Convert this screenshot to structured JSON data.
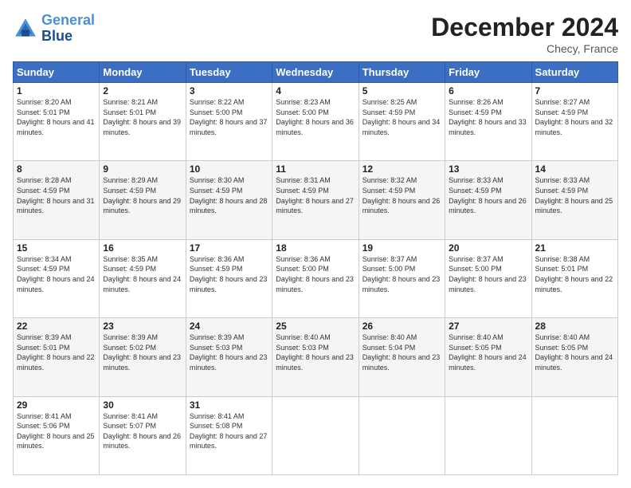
{
  "logo": {
    "line1": "General",
    "line2": "Blue"
  },
  "title": "December 2024",
  "location": "Checy, France",
  "days_of_week": [
    "Sunday",
    "Monday",
    "Tuesday",
    "Wednesday",
    "Thursday",
    "Friday",
    "Saturday"
  ],
  "weeks": [
    [
      {
        "day": "1",
        "sunrise": "Sunrise: 8:20 AM",
        "sunset": "Sunset: 5:01 PM",
        "daylight": "Daylight: 8 hours and 41 minutes."
      },
      {
        "day": "2",
        "sunrise": "Sunrise: 8:21 AM",
        "sunset": "Sunset: 5:01 PM",
        "daylight": "Daylight: 8 hours and 39 minutes."
      },
      {
        "day": "3",
        "sunrise": "Sunrise: 8:22 AM",
        "sunset": "Sunset: 5:00 PM",
        "daylight": "Daylight: 8 hours and 37 minutes."
      },
      {
        "day": "4",
        "sunrise": "Sunrise: 8:23 AM",
        "sunset": "Sunset: 5:00 PM",
        "daylight": "Daylight: 8 hours and 36 minutes."
      },
      {
        "day": "5",
        "sunrise": "Sunrise: 8:25 AM",
        "sunset": "Sunset: 4:59 PM",
        "daylight": "Daylight: 8 hours and 34 minutes."
      },
      {
        "day": "6",
        "sunrise": "Sunrise: 8:26 AM",
        "sunset": "Sunset: 4:59 PM",
        "daylight": "Daylight: 8 hours and 33 minutes."
      },
      {
        "day": "7",
        "sunrise": "Sunrise: 8:27 AM",
        "sunset": "Sunset: 4:59 PM",
        "daylight": "Daylight: 8 hours and 32 minutes."
      }
    ],
    [
      {
        "day": "8",
        "sunrise": "Sunrise: 8:28 AM",
        "sunset": "Sunset: 4:59 PM",
        "daylight": "Daylight: 8 hours and 31 minutes."
      },
      {
        "day": "9",
        "sunrise": "Sunrise: 8:29 AM",
        "sunset": "Sunset: 4:59 PM",
        "daylight": "Daylight: 8 hours and 29 minutes."
      },
      {
        "day": "10",
        "sunrise": "Sunrise: 8:30 AM",
        "sunset": "Sunset: 4:59 PM",
        "daylight": "Daylight: 8 hours and 28 minutes."
      },
      {
        "day": "11",
        "sunrise": "Sunrise: 8:31 AM",
        "sunset": "Sunset: 4:59 PM",
        "daylight": "Daylight: 8 hours and 27 minutes."
      },
      {
        "day": "12",
        "sunrise": "Sunrise: 8:32 AM",
        "sunset": "Sunset: 4:59 PM",
        "daylight": "Daylight: 8 hours and 26 minutes."
      },
      {
        "day": "13",
        "sunrise": "Sunrise: 8:33 AM",
        "sunset": "Sunset: 4:59 PM",
        "daylight": "Daylight: 8 hours and 26 minutes."
      },
      {
        "day": "14",
        "sunrise": "Sunrise: 8:33 AM",
        "sunset": "Sunset: 4:59 PM",
        "daylight": "Daylight: 8 hours and 25 minutes."
      }
    ],
    [
      {
        "day": "15",
        "sunrise": "Sunrise: 8:34 AM",
        "sunset": "Sunset: 4:59 PM",
        "daylight": "Daylight: 8 hours and 24 minutes."
      },
      {
        "day": "16",
        "sunrise": "Sunrise: 8:35 AM",
        "sunset": "Sunset: 4:59 PM",
        "daylight": "Daylight: 8 hours and 24 minutes."
      },
      {
        "day": "17",
        "sunrise": "Sunrise: 8:36 AM",
        "sunset": "Sunset: 4:59 PM",
        "daylight": "Daylight: 8 hours and 23 minutes."
      },
      {
        "day": "18",
        "sunrise": "Sunrise: 8:36 AM",
        "sunset": "Sunset: 5:00 PM",
        "daylight": "Daylight: 8 hours and 23 minutes."
      },
      {
        "day": "19",
        "sunrise": "Sunrise: 8:37 AM",
        "sunset": "Sunset: 5:00 PM",
        "daylight": "Daylight: 8 hours and 23 minutes."
      },
      {
        "day": "20",
        "sunrise": "Sunrise: 8:37 AM",
        "sunset": "Sunset: 5:00 PM",
        "daylight": "Daylight: 8 hours and 23 minutes."
      },
      {
        "day": "21",
        "sunrise": "Sunrise: 8:38 AM",
        "sunset": "Sunset: 5:01 PM",
        "daylight": "Daylight: 8 hours and 22 minutes."
      }
    ],
    [
      {
        "day": "22",
        "sunrise": "Sunrise: 8:39 AM",
        "sunset": "Sunset: 5:01 PM",
        "daylight": "Daylight: 8 hours and 22 minutes."
      },
      {
        "day": "23",
        "sunrise": "Sunrise: 8:39 AM",
        "sunset": "Sunset: 5:02 PM",
        "daylight": "Daylight: 8 hours and 23 minutes."
      },
      {
        "day": "24",
        "sunrise": "Sunrise: 8:39 AM",
        "sunset": "Sunset: 5:03 PM",
        "daylight": "Daylight: 8 hours and 23 minutes."
      },
      {
        "day": "25",
        "sunrise": "Sunrise: 8:40 AM",
        "sunset": "Sunset: 5:03 PM",
        "daylight": "Daylight: 8 hours and 23 minutes."
      },
      {
        "day": "26",
        "sunrise": "Sunrise: 8:40 AM",
        "sunset": "Sunset: 5:04 PM",
        "daylight": "Daylight: 8 hours and 23 minutes."
      },
      {
        "day": "27",
        "sunrise": "Sunrise: 8:40 AM",
        "sunset": "Sunset: 5:05 PM",
        "daylight": "Daylight: 8 hours and 24 minutes."
      },
      {
        "day": "28",
        "sunrise": "Sunrise: 8:40 AM",
        "sunset": "Sunset: 5:05 PM",
        "daylight": "Daylight: 8 hours and 24 minutes."
      }
    ],
    [
      {
        "day": "29",
        "sunrise": "Sunrise: 8:41 AM",
        "sunset": "Sunset: 5:06 PM",
        "daylight": "Daylight: 8 hours and 25 minutes."
      },
      {
        "day": "30",
        "sunrise": "Sunrise: 8:41 AM",
        "sunset": "Sunset: 5:07 PM",
        "daylight": "Daylight: 8 hours and 26 minutes."
      },
      {
        "day": "31",
        "sunrise": "Sunrise: 8:41 AM",
        "sunset": "Sunset: 5:08 PM",
        "daylight": "Daylight: 8 hours and 27 minutes."
      },
      null,
      null,
      null,
      null
    ]
  ]
}
